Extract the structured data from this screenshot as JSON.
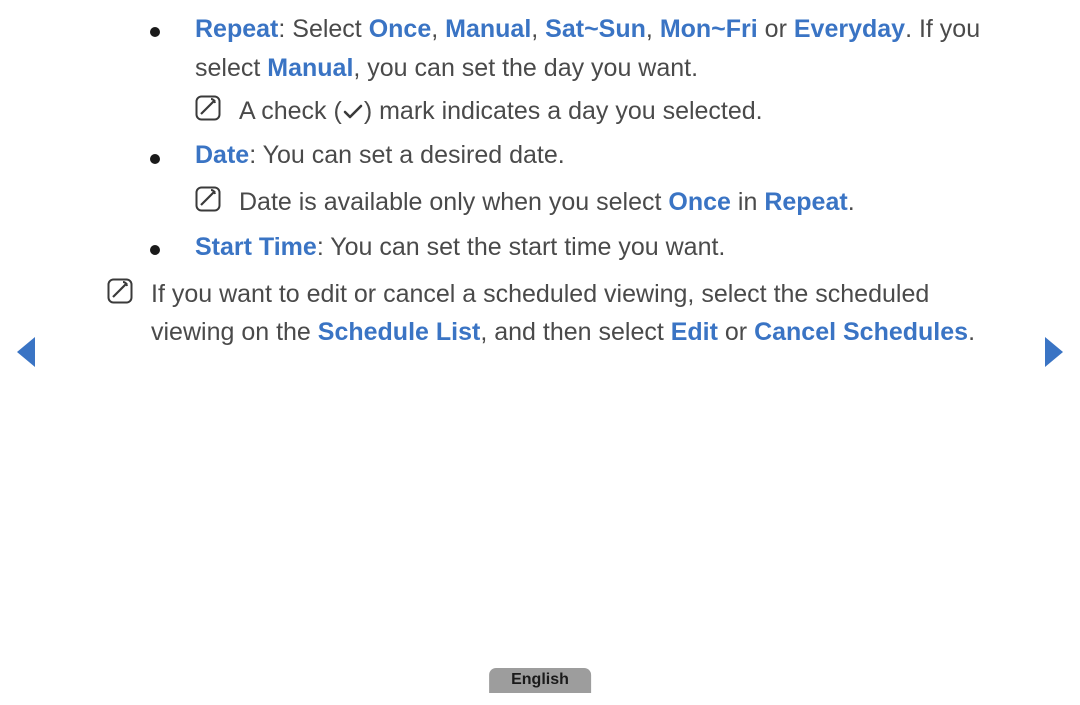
{
  "bullets": {
    "repeat": {
      "label": "Repeat",
      "pre": ": Select ",
      "opt1": "Once",
      "sep1": ", ",
      "opt2": "Manual",
      "sep2": ", ",
      "opt3": "Sat~Sun",
      "sep3": ", ",
      "opt4": "Mon~Fri",
      "sep4": " or ",
      "opt5": "Everyday",
      "post1": ". If you select ",
      "opt6": "Manual",
      "post2": ", you can set the day you want."
    },
    "repeat_note": {
      "pre": "A check (",
      "post": ") mark indicates a day you selected."
    },
    "date": {
      "label": "Date",
      "text": ": You can set a desired date."
    },
    "date_note": {
      "pre": "Date is available only when you select ",
      "opt1": "Once",
      "mid": " in ",
      "opt2": "Repeat",
      "post": "."
    },
    "start": {
      "label": "Start Time",
      "text": ": You can set the start time you want."
    },
    "outer_note": {
      "pre": "If you want to edit or cancel a scheduled viewing, select the scheduled viewing on the ",
      "opt1": "Schedule List",
      "mid1": ", and then select ",
      "opt2": "Edit",
      "mid2": " or ",
      "opt3": "Cancel Schedules",
      "post": "."
    }
  },
  "footer": {
    "language": "English"
  }
}
